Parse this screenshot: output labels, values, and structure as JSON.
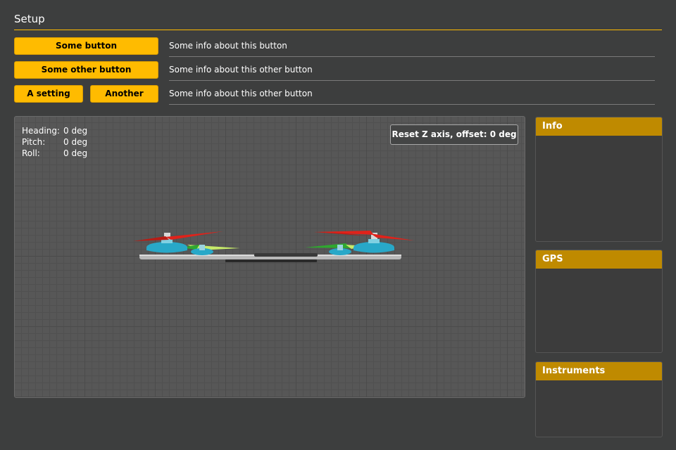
{
  "header": {
    "title": "Setup"
  },
  "controls": [
    {
      "buttons": [
        {
          "label": "Some button"
        }
      ],
      "info": "Some info about this button"
    },
    {
      "buttons": [
        {
          "label": "Some other button"
        }
      ],
      "info": "Some info about this other button"
    },
    {
      "buttons": [
        {
          "label": "A setting"
        },
        {
          "label": "Another"
        }
      ],
      "info": "Some info about this other button"
    }
  ],
  "viewer": {
    "attitude": [
      {
        "label": "Heading:",
        "value": "0 deg"
      },
      {
        "label": "Pitch:",
        "value": "0 deg"
      },
      {
        "label": "Roll:",
        "value": "0 deg"
      }
    ],
    "reset_label": "Reset Z axis, offset: 0 deg"
  },
  "panels": {
    "info": {
      "title": "Info"
    },
    "gps": {
      "title": "GPS"
    },
    "instruments": {
      "title": "Instruments"
    }
  },
  "colors": {
    "accent": "#ffbb00",
    "panel_header": "#bf8a00",
    "background": "#3d3e3e",
    "propeller_red": "#e0221a",
    "propeller_green": "#2fa82f",
    "motor_cyan": "#28a8c8"
  }
}
